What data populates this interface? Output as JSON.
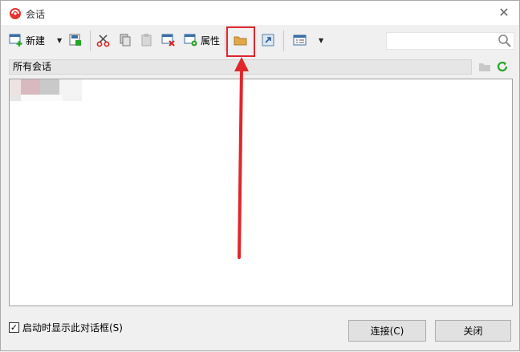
{
  "window": {
    "title": "会话"
  },
  "toolbar": {
    "new_label": "新建",
    "properties_label": "属性"
  },
  "path": {
    "label": "所有会话"
  },
  "footer": {
    "startup_label": "启动时显示此对话框(S)",
    "startup_checked": true,
    "connect_label": "连接(C)",
    "close_label": "关闭"
  },
  "icons": {
    "app": "app-logo-icon",
    "new": "new-session-icon",
    "save": "save-icon",
    "cut": "cut-icon",
    "copy": "copy-icon",
    "paste": "paste-icon",
    "delete": "delete-icon",
    "properties": "properties-icon",
    "folder": "new-folder-icon",
    "shortcut": "shortcut-icon",
    "view": "view-options-icon",
    "search": "search-icon",
    "refresh": "refresh-icon"
  },
  "colors": {
    "highlight": "#e0262b",
    "refresh": "#2aa52a",
    "folder": "#e0a84a"
  }
}
